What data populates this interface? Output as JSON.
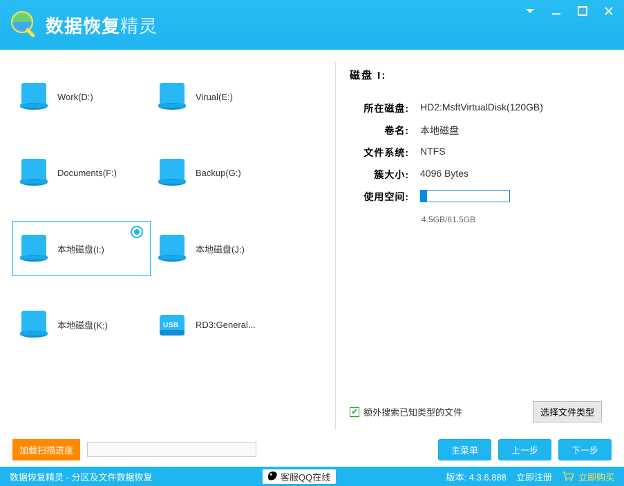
{
  "header": {
    "title_main": "数据恢复",
    "title_accent": "精灵"
  },
  "disks": [
    {
      "label": "Work(D:)",
      "type": "hdd"
    },
    {
      "label": "Virual(E:)",
      "type": "hdd"
    },
    {
      "label": "Documents(F:)",
      "type": "hdd"
    },
    {
      "label": "Backup(G:)",
      "type": "hdd"
    },
    {
      "label": "本地磁盘(I:)",
      "type": "hdd",
      "selected": true
    },
    {
      "label": "本地磁盘(J:)",
      "type": "hdd"
    },
    {
      "label": "本地磁盘(K:)",
      "type": "hdd"
    },
    {
      "label": "RD3:General...",
      "type": "usb"
    }
  ],
  "details": {
    "title": "磁盘 I:",
    "labels": {
      "location": "所在磁盘:",
      "volume": "卷名:",
      "fs": "文件系统:",
      "cluster": "簇大小:",
      "usage": "使用空间:"
    },
    "location": "HD2:MsftVirtualDisk(120GB)",
    "volume": "本地磁盘",
    "fs": "NTFS",
    "cluster": "4096 Bytes",
    "usage_percent": 7,
    "usage_text": "4.5GB/61.5GB"
  },
  "options": {
    "extra_search": "额外搜索已知类型的文件",
    "select_types": "选择文件类型"
  },
  "buttons": {
    "load_progress": "加载扫描进度",
    "main_menu": "主菜单",
    "prev": "上一步",
    "next": "下一步"
  },
  "status": {
    "app_mode": "数据恢复精灵 - 分区及文件数据恢复",
    "qq": "客服QQ在线",
    "version_label": "版本: 4.3.6.888",
    "register": "立即注册",
    "buy": "立即购买"
  }
}
